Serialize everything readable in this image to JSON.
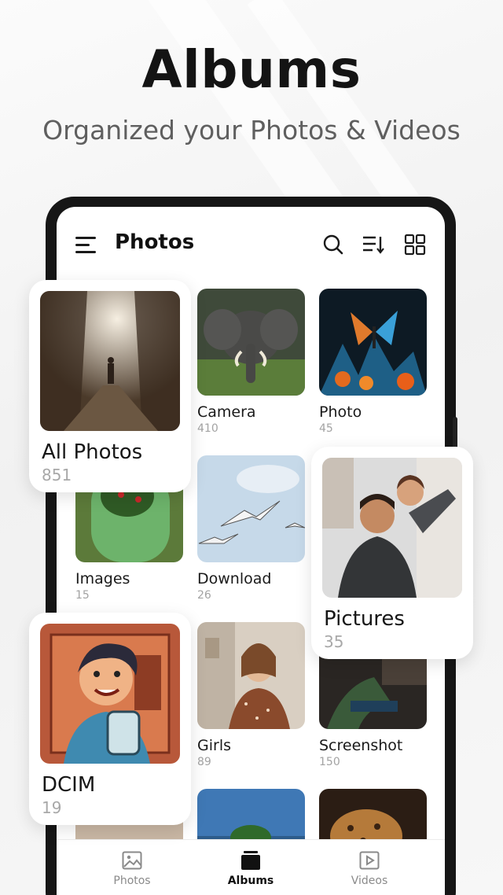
{
  "header": {
    "title": "Albums",
    "subtitle": "Organized your Photos & Videos"
  },
  "app_bar": {
    "title": "Photos",
    "icons": [
      "menu-icon",
      "search-icon",
      "sort-icon",
      "grid-view-icon"
    ]
  },
  "albums": [
    {
      "name": "Camera",
      "count": "410"
    },
    {
      "name": "Photo",
      "count": "45"
    },
    {
      "name": "Images",
      "count": "15"
    },
    {
      "name": "Download",
      "count": "26"
    },
    {
      "name": "Girls",
      "count": "89"
    },
    {
      "name": "Screenshot",
      "count": "150"
    }
  ],
  "highlighted": [
    {
      "name": "All Photos",
      "count": "851"
    },
    {
      "name": "Pictures",
      "count": "35"
    },
    {
      "name": "DCIM",
      "count": "19"
    }
  ],
  "bottom_nav": [
    {
      "label": "Photos",
      "icon": "image-icon",
      "active": false
    },
    {
      "label": "Albums",
      "icon": "albums-icon",
      "active": true
    },
    {
      "label": "Videos",
      "icon": "video-icon",
      "active": false
    }
  ],
  "colors": {
    "accent": "#111111",
    "muted_text": "#a3a3a3",
    "subtitle_text": "#5f5f5f"
  }
}
